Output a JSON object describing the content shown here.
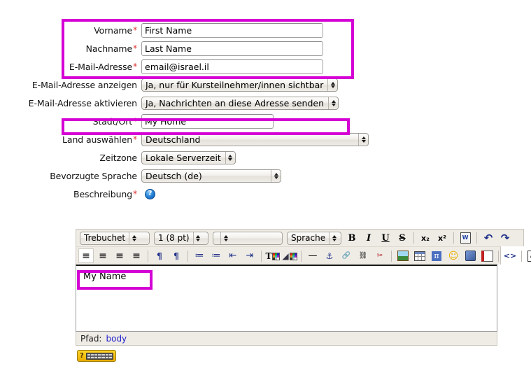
{
  "form": {
    "rows": [
      {
        "label": "Vorname",
        "required": true,
        "type": "text",
        "value": "First Name",
        "placeholder": ""
      },
      {
        "label": "Nachname",
        "required": true,
        "type": "text",
        "value": "Last Name",
        "placeholder": ""
      },
      {
        "label": "E-Mail-Adresse",
        "required": true,
        "type": "text",
        "value": "email@israel.il",
        "placeholder": ""
      },
      {
        "label": "E-Mail-Adresse anzeigen",
        "required": false,
        "type": "select",
        "value": "Ja, nur für Kursteilnehmer/innen sichtbar"
      },
      {
        "label": "E-Mail-Adresse aktivieren",
        "required": false,
        "type": "select",
        "value": "Ja, Nachrichten an diese Adresse senden"
      },
      {
        "label": "Stadt/Ort",
        "required": true,
        "type": "text",
        "value": "My Home",
        "placeholder": ""
      },
      {
        "label": "Land auswählen",
        "required": true,
        "type": "select",
        "value": "Deutschland"
      },
      {
        "label": "Zeitzone",
        "required": false,
        "type": "select",
        "value": "Lokale Serverzeit"
      },
      {
        "label": "Bevorzugte Sprache",
        "required": false,
        "type": "select",
        "value": "Deutsch (de)"
      },
      {
        "label": "Beschreibung",
        "required": true,
        "type": "help",
        "value": ""
      }
    ],
    "required_marker": "*"
  },
  "editor": {
    "font_select": "Trebuchet",
    "size_select": "1 (8 pt)",
    "format_select": "",
    "language_select": "Sprache",
    "toolbar_row1": [
      {
        "name": "bold-button",
        "glyph": "B"
      },
      {
        "name": "italic-button",
        "glyph": "I"
      },
      {
        "name": "underline-button",
        "glyph": "U"
      },
      {
        "name": "strikethrough-button",
        "glyph": "S"
      },
      {
        "name": "subscript-button",
        "glyph": "x₂"
      },
      {
        "name": "superscript-button",
        "glyph": "x²"
      },
      {
        "name": "clean-word-html-button",
        "glyph": "W"
      },
      {
        "name": "undo-button",
        "glyph": "↶"
      },
      {
        "name": "redo-button",
        "glyph": "↷"
      }
    ],
    "toolbar_row2": [
      {
        "name": "align-left-button",
        "glyph": "≡"
      },
      {
        "name": "align-center-button",
        "glyph": "≡"
      },
      {
        "name": "align-right-button",
        "glyph": "≡"
      },
      {
        "name": "align-justify-button",
        "glyph": "≡"
      },
      {
        "name": "direction-ltr-button",
        "glyph": "¶"
      },
      {
        "name": "direction-rtl-button",
        "glyph": "¶"
      },
      {
        "name": "ordered-list-button",
        "glyph": "≔"
      },
      {
        "name": "unordered-list-button",
        "glyph": "≔"
      },
      {
        "name": "outdent-button",
        "glyph": "⇤"
      },
      {
        "name": "indent-button",
        "glyph": "⇥"
      },
      {
        "name": "text-color-button",
        "glyph": "T"
      },
      {
        "name": "background-color-button",
        "glyph": "◢"
      },
      {
        "name": "horizontal-rule-button",
        "glyph": "—"
      },
      {
        "name": "anchor-button",
        "glyph": "⚓"
      },
      {
        "name": "insert-link-button",
        "glyph": "🔗"
      },
      {
        "name": "unlink-button",
        "glyph": "⛓"
      },
      {
        "name": "remove-link-button",
        "glyph": "✂"
      },
      {
        "name": "insert-image-button",
        "glyph": "🖼"
      },
      {
        "name": "insert-table-button",
        "glyph": "▦"
      },
      {
        "name": "insert-formula-button",
        "glyph": "π"
      },
      {
        "name": "insert-emoticon-button",
        "glyph": "☺"
      },
      {
        "name": "insert-media-button",
        "glyph": "◈"
      },
      {
        "name": "insert-file-button",
        "glyph": "▤"
      },
      {
        "name": "html-source-button",
        "glyph": "<>"
      },
      {
        "name": "fullscreen-button",
        "glyph": "⤢"
      }
    ],
    "content": "My Name",
    "status_label": "Pfad:",
    "status_value": "body"
  },
  "colors": {
    "highlight": "#d400d4",
    "required": "#e03030",
    "link": "#2222cc",
    "toolbar_bg": "#efece6",
    "help_button": "#f5c211"
  }
}
